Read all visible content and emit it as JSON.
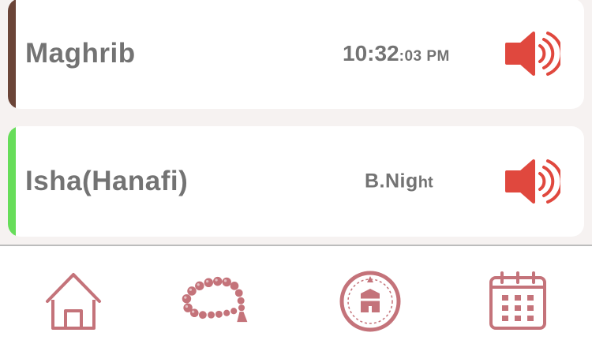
{
  "prayers": [
    {
      "name": "Maghrib",
      "time_main": "10:32",
      "time_small": ":03 PM",
      "accent": "#6b4538",
      "sound_icon": "speaker-volume-icon"
    },
    {
      "name": "Isha(Hanafi)",
      "time_main": "B.Nig",
      "time_small": "ht",
      "accent": "#67dd5a",
      "sound_icon": "speaker-volume-icon"
    }
  ],
  "colors": {
    "list_background": "#f6f2f1",
    "text": "#737373",
    "speaker_red": "#e0483e",
    "tab_icon": "#c4737a",
    "divider": "#bcbcbc"
  },
  "tab_bar": {
    "items": [
      {
        "id": "home",
        "icon": "home-icon"
      },
      {
        "id": "tasbih",
        "icon": "prayer-beads-icon"
      },
      {
        "id": "qibla",
        "icon": "kaaba-compass-icon"
      },
      {
        "id": "calendar",
        "icon": "calendar-icon"
      }
    ]
  }
}
